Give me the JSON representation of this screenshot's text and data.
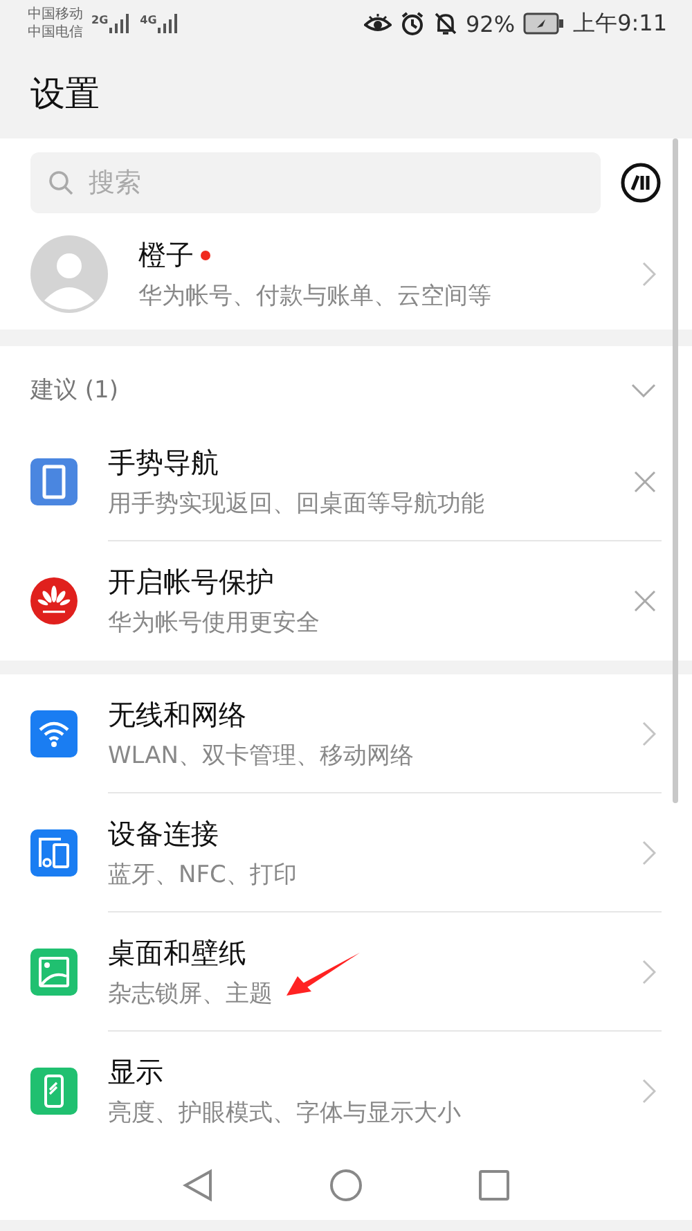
{
  "status_bar": {
    "carriers": [
      {
        "name": "中国移动",
        "network": "2G"
      },
      {
        "name": "中国电信",
        "network": "4G"
      }
    ],
    "battery": "92%",
    "time": "上午9:11"
  },
  "title": "设置",
  "search": {
    "placeholder": "搜索"
  },
  "account": {
    "name": "橙子",
    "unread": true,
    "subtitle": "华为帐号、付款与账单、云空间等"
  },
  "suggestions": {
    "header": "建议 (1)",
    "expanded": true,
    "items": [
      {
        "kind": "gesture",
        "color": "#4a86e0",
        "title": "手势导航",
        "subtitle": "用手势实现返回、回桌面等导航功能"
      },
      {
        "kind": "brand",
        "color": "#e0201d",
        "title": "开启帐号保护",
        "subtitle": "华为帐号使用更安全"
      }
    ]
  },
  "settings": [
    {
      "kind": "wifi",
      "color": "#1a7df2",
      "title": "无线和网络",
      "subtitle": "WLAN、双卡管理、移动网络"
    },
    {
      "kind": "devices",
      "color": "#1a7df2",
      "title": "设备连接",
      "subtitle": "蓝牙、NFC、打印"
    },
    {
      "kind": "wallpaper",
      "color": "#20c070",
      "title": "桌面和壁纸",
      "subtitle": "杂志锁屏、主题"
    },
    {
      "kind": "display",
      "color": "#20c070",
      "title": "显示",
      "subtitle": "亮度、护眼模式、字体与显示大小"
    }
  ]
}
